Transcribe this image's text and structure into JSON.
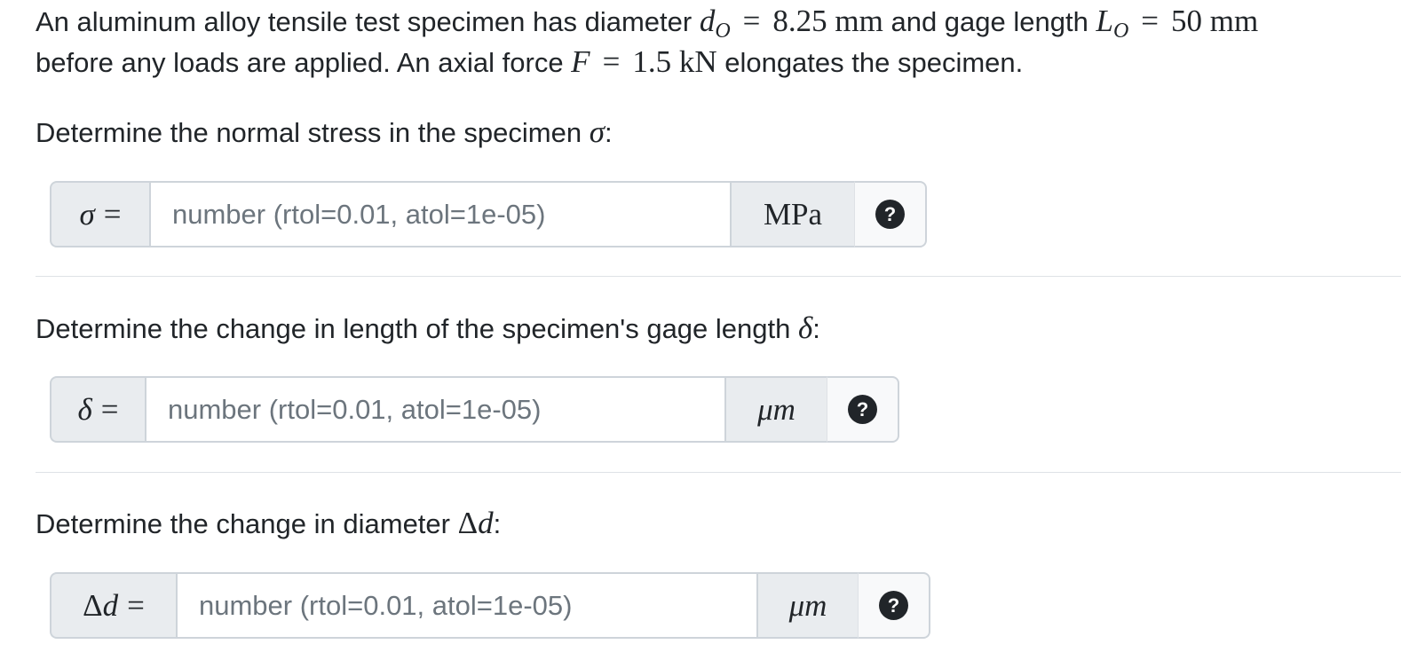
{
  "problem": {
    "t1": "An aluminum alloy tensile test specimen has diameter ",
    "d_sym": "d",
    "d_sub": "O",
    "eq": "=",
    "d_val": "8.25 mm",
    "t2": " and gage length ",
    "l_sym": "L",
    "l_sub": "O",
    "l_val": "50 mm",
    "t3": "before any loads are applied. An axial force ",
    "f_sym": "F",
    "f_val": "1.5 kN",
    "t4": " elongates the specimen."
  },
  "questions": [
    {
      "prompt": "Determine the normal stress in the specimen ",
      "symbol": "σ",
      "label_symbol": "σ",
      "label_eq": "=",
      "placeholder": "number (rtol=0.01, atol=1e-05)",
      "unit": "MPa",
      "help_icon": "question-circle-icon",
      "help_glyph": "?"
    },
    {
      "prompt": "Determine the change in length of the specimen's gage length ",
      "symbol": "δ",
      "label_symbol": "δ",
      "label_eq": "=",
      "placeholder": "number (rtol=0.01, atol=1e-05)",
      "unit": "μm",
      "help_icon": "question-circle-icon",
      "help_glyph": "?"
    },
    {
      "prompt": "Determine the change in diameter ",
      "symbol": "Δ",
      "symbol2": "d",
      "label_symbol": "Δ",
      "label_symbol2": "d",
      "label_eq": "=",
      "placeholder": "number (rtol=0.01, atol=1e-05)",
      "unit": "μm",
      "help_icon": "question-circle-icon",
      "help_glyph": "?"
    }
  ],
  "colon": ":"
}
